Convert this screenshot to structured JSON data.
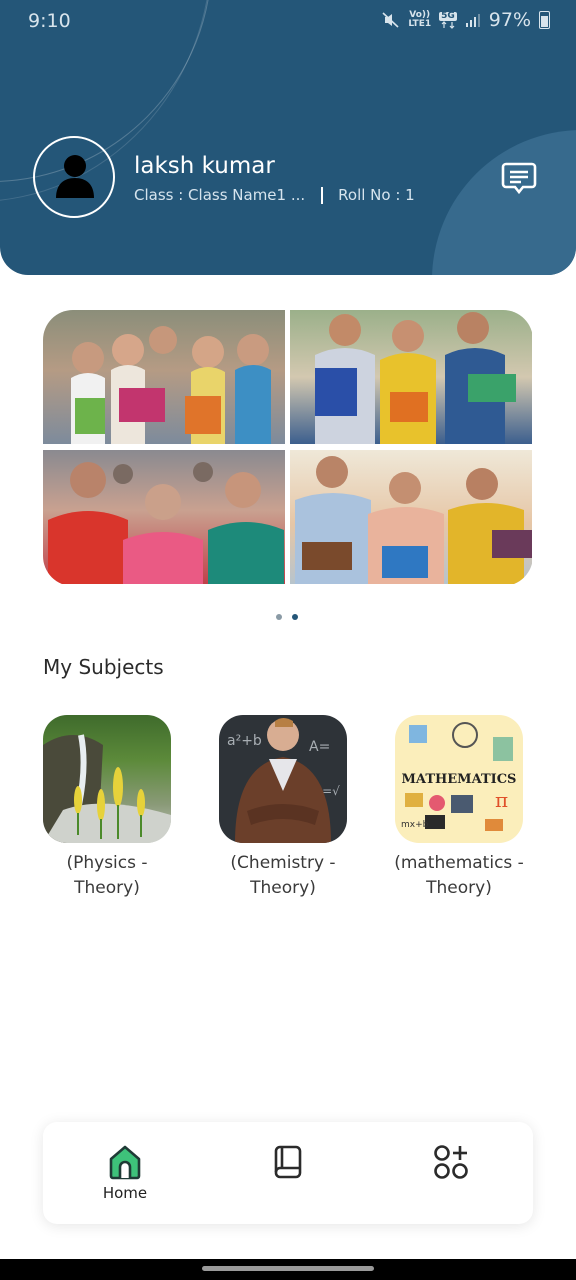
{
  "status_bar": {
    "time": "9:10",
    "network_top": "Vo))",
    "network_bottom": "LTE1",
    "signal_label": "5G",
    "battery": "97%"
  },
  "profile": {
    "name": "laksh kumar",
    "class_label": "Class : Class Name1 ...",
    "roll_label": "Roll No : 1"
  },
  "carousel": {
    "page_count": 2,
    "active_index": 1
  },
  "subjects_section": {
    "title": "My Subjects",
    "items": [
      {
        "label": "(Physics - Theory)",
        "thumb_icon": "waterfall-flowers-image"
      },
      {
        "label": "(Chemistry - Theory)",
        "thumb_icon": "teacher-chalkboard-image"
      },
      {
        "label": "(mathematics - Theory)",
        "thumb_icon": "mathematics-collage-image",
        "thumb_text": "MATHEMATICS"
      }
    ]
  },
  "bottom_nav": {
    "items": [
      {
        "label": "Home",
        "icon": "home-icon",
        "active": true
      },
      {
        "label": "",
        "icon": "book-icon",
        "active": false
      },
      {
        "label": "",
        "icon": "apps-add-icon",
        "active": false
      }
    ]
  },
  "colors": {
    "header_bg": "#245678",
    "accent_green": "#3ec27a",
    "dot_active": "#245678"
  }
}
